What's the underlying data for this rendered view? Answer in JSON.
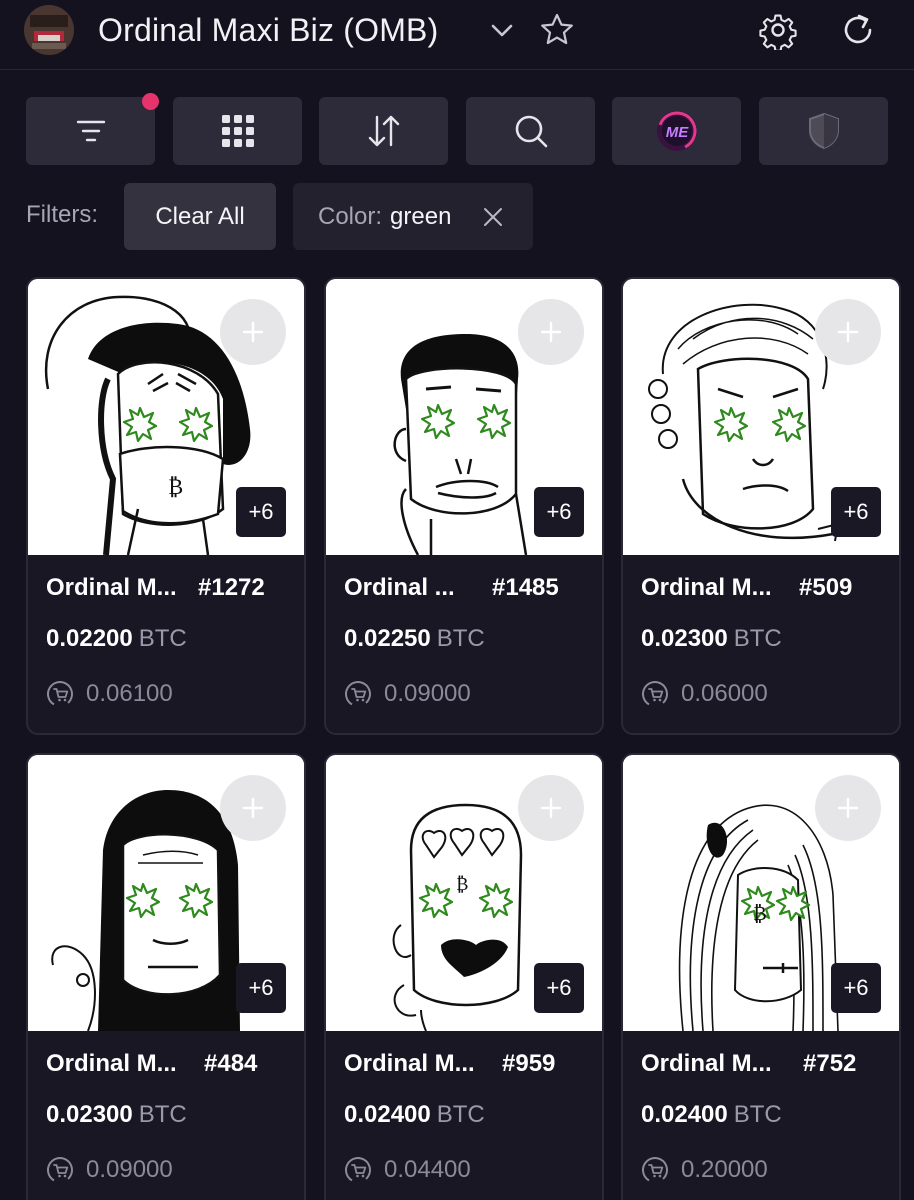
{
  "header": {
    "title": "Ordinal Maxi Biz (OMB)"
  },
  "toolbar": {
    "buttons": [
      "filter-icon",
      "grid-icon",
      "sort-icon",
      "search-icon",
      "magic-eden-icon",
      "shield-icon"
    ],
    "filter_indicator_color": "#e5336b"
  },
  "filters": {
    "label": "Filters:",
    "clear_all": "Clear All",
    "active": [
      {
        "key": "Color:",
        "value": "green"
      }
    ]
  },
  "listing": {
    "currency": "BTC",
    "items": [
      {
        "name": "Ordinal M...",
        "number": "#1272",
        "price": "0.02200",
        "currency": "BTC",
        "last_sale": "0.06100",
        "badge": "+6"
      },
      {
        "name": "Ordinal ...",
        "number": "#1485",
        "price": "0.02250",
        "currency": "BTC",
        "last_sale": "0.09000",
        "badge": "+6"
      },
      {
        "name": "Ordinal M...",
        "number": "#509",
        "price": "0.02300",
        "currency": "BTC",
        "last_sale": "0.06000",
        "badge": "+6"
      },
      {
        "name": "Ordinal M...",
        "number": "#484",
        "price": "0.02300",
        "currency": "BTC",
        "last_sale": "0.09000",
        "badge": "+6"
      },
      {
        "name": "Ordinal M...",
        "number": "#959",
        "price": "0.02400",
        "currency": "BTC",
        "last_sale": "0.04400",
        "badge": "+6"
      },
      {
        "name": "Ordinal M...",
        "number": "#752",
        "price": "0.02400",
        "currency": "BTC",
        "last_sale": "0.20000",
        "badge": "+6"
      }
    ]
  },
  "colors": {
    "background": "#15121f",
    "card": "#1a1725",
    "button": "#2d2a3a",
    "eye_green": "#2f8a1e"
  }
}
